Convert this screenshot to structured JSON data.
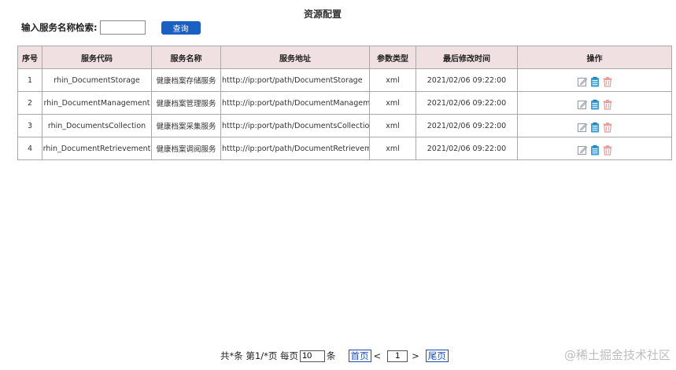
{
  "page": {
    "title": "资源配置"
  },
  "search": {
    "label": "输入服务名称检索:",
    "value": "",
    "button_label": "查询"
  },
  "table": {
    "headers": [
      "序号",
      "服务代码",
      "服务名称",
      "服务地址",
      "参数类型",
      "最后修改时间",
      "操作"
    ],
    "rows": [
      {
        "index": "1",
        "code": "rhin_DocumentStorage",
        "name": "健康档案存储服务",
        "url": "htttp://ip:port/path/DocumentStorage",
        "param_type": "xml",
        "modified": "2021/02/06 09:22:00"
      },
      {
        "index": "2",
        "code": "rhin_DocumentManagement",
        "name": "健康档案管理服务",
        "url": "htttp://ip:port/path/DocumentManagement",
        "param_type": "xml",
        "modified": "2021/02/06 09:22:00"
      },
      {
        "index": "3",
        "code": "rhin_DocumentsCollection",
        "name": "健康档案采集服务",
        "url": "htttp://ip:port/path/DocumentsCollection",
        "param_type": "xml",
        "modified": "2021/02/06 09:22:00"
      },
      {
        "index": "4",
        "code": "rhin_DocumentRetrievement",
        "name": "健康档案调阅服务",
        "url": "htttp://ip:port/path/DocumentRetrievement",
        "param_type": "xml",
        "modified": "2021/02/06 09:22:00"
      }
    ],
    "row_actions": [
      "edit-icon",
      "clipboard-icon",
      "trash-icon"
    ]
  },
  "pager": {
    "summary": "共*条 第1/*页 每页",
    "page_size": "10",
    "unit": "条",
    "first_label": "首页",
    "prev_label": "<",
    "current_page": "1",
    "next_label": ">",
    "last_label": "尾页"
  },
  "watermark": "@稀土掘金技术社区",
  "colors": {
    "header_bg": "#f0e0e2",
    "button_bg": "#1a5fc4",
    "link": "#1a4fb8",
    "edit_icon": "#9aa0a6",
    "clipboard_icon": "#3b9fd6",
    "trash_icon": "#e89a9a"
  }
}
